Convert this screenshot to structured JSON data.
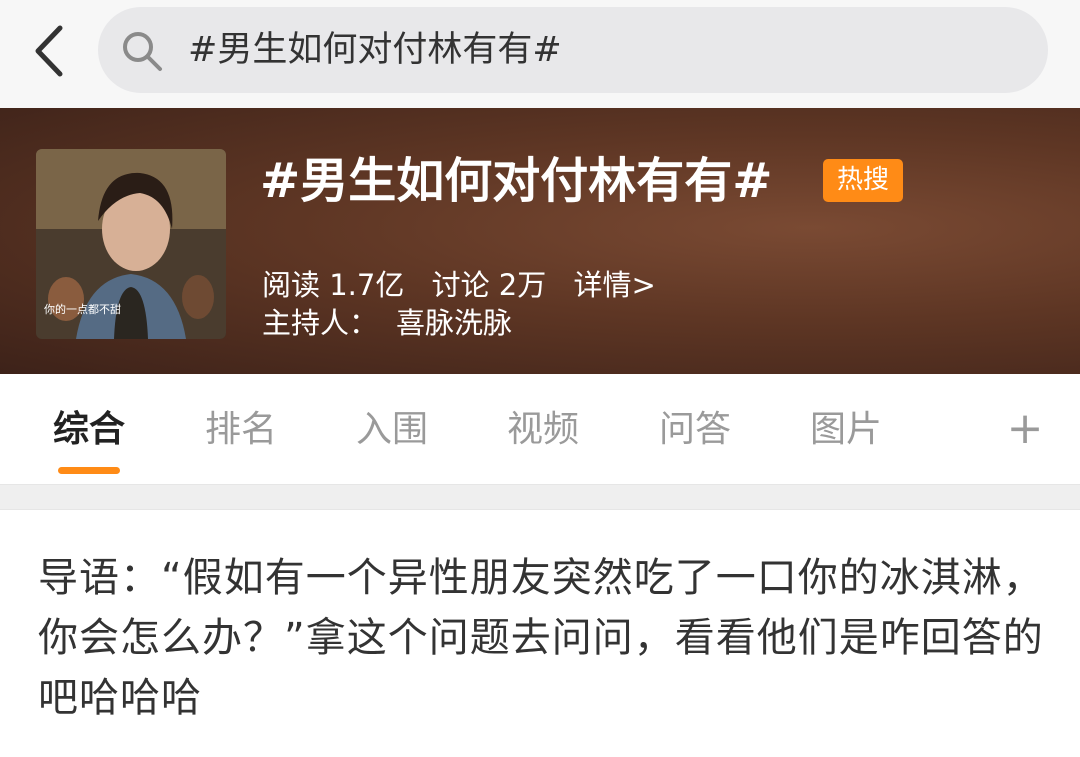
{
  "search": {
    "value": "#男生如何对付林有有#"
  },
  "topic": {
    "title": "#男生如何对付林有有#",
    "badge": "热搜",
    "thumb_caption": "你的一点都不甜",
    "reads": "阅读 1.7亿",
    "discussions": "讨论 2万",
    "detail": "详情>",
    "host_label": "主持人：",
    "host_name": "喜脉洗脉"
  },
  "tabs": [
    {
      "label": "综合",
      "active": true
    },
    {
      "label": "排名"
    },
    {
      "label": "入围"
    },
    {
      "label": "视频"
    },
    {
      "label": "问答"
    },
    {
      "label": "图片"
    }
  ],
  "plus_label": "+",
  "intro": {
    "text": "导语：“假如有一个异性朋友突然吃了一口你的冰淇淋，你会怎么办？”拿这个问题去问问，看看他们是咋回答的吧哈哈哈"
  },
  "colors": {
    "accent": "#ff8b16",
    "banner_mid": "#5e3624"
  },
  "icons": {
    "back": "chevron-left-icon",
    "search": "search-icon"
  }
}
